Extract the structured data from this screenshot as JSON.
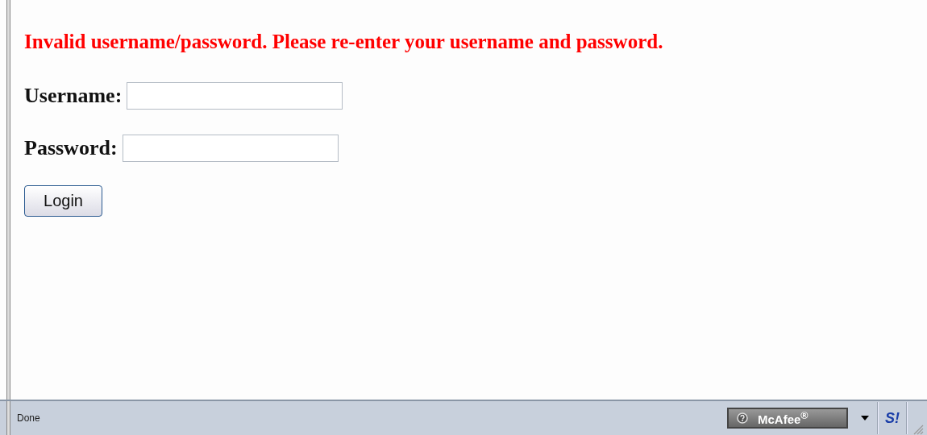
{
  "error_message": "Invalid username/password. Please re-enter your username and password.",
  "fields": [
    {
      "label": "Username:"
    },
    {
      "label": "Password:"
    }
  ],
  "login_button": "Login",
  "status_bar": {
    "text": "Done",
    "mcafee_button": "McAfee$^{®}$",
    "security_icon": "S!"
  }
}
